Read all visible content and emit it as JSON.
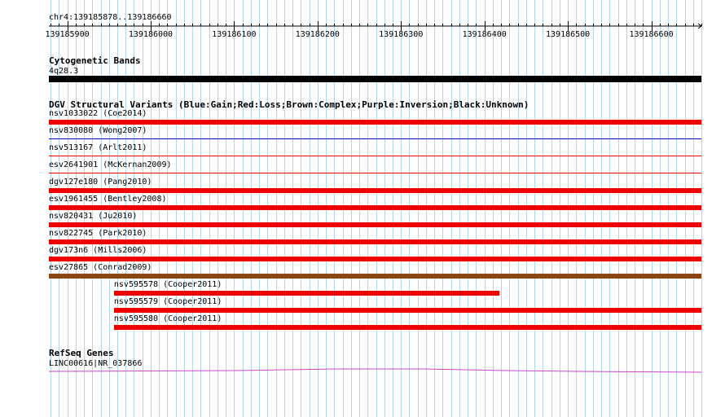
{
  "region": {
    "label": "chr4:139185878..139186660",
    "start": 139185878,
    "end": 139186660
  },
  "ruler": {
    "ticks": [
      {
        "pos": 139185900,
        "label": "139185900"
      },
      {
        "pos": 139186000,
        "label": "139186000"
      },
      {
        "pos": 139186100,
        "label": "139186100"
      },
      {
        "pos": 139186200,
        "label": "139186200"
      },
      {
        "pos": 139186300,
        "label": "139186300"
      },
      {
        "pos": 139186400,
        "label": "139186400"
      },
      {
        "pos": 139186500,
        "label": "139186500"
      },
      {
        "pos": 139186600,
        "label": "139186600"
      }
    ]
  },
  "colors": {
    "grid": "#b0d8e8",
    "ruler": "#000000",
    "band": "#000000",
    "gain": "#0000cc",
    "loss": "#ee0000",
    "complex": "#8b4513",
    "gene": "#cc44cc"
  },
  "tracks": {
    "cytoband": {
      "title": "Cytogenetic Bands",
      "feature": {
        "label": "4q28.3",
        "start": 139185878,
        "end": 139186660
      }
    },
    "dgv": {
      "title": "DGV Structural Variants (Blue:Gain;Red:Loss;Brown:Complex;Purple:Inversion;Black:Unknown)",
      "features": [
        {
          "label": "nsv1033022 (Coe2014)",
          "type": "loss",
          "style": "thick",
          "start": 139185878,
          "end": 139186660
        },
        {
          "label": "nsv830080 (Wong2007)",
          "type": "gain",
          "style": "thin",
          "start": 139185878,
          "end": 139186660
        },
        {
          "label": "nsv513167 (Arlt2011)",
          "type": "loss",
          "style": "thin",
          "start": 139185878,
          "end": 139186660
        },
        {
          "label": "esv2641901 (McKernan2009)",
          "type": "loss",
          "style": "thin",
          "start": 139185878,
          "end": 139186660
        },
        {
          "label": "dgv127e180 (Pang2010)",
          "type": "loss",
          "style": "thick",
          "start": 139185878,
          "end": 139186660
        },
        {
          "label": "esv1961455 (Bentley2008)",
          "type": "loss",
          "style": "thick",
          "start": 139185878,
          "end": 139186660
        },
        {
          "label": "nsv820431 (Ju2010)",
          "type": "loss",
          "style": "thick",
          "start": 139185878,
          "end": 139186660
        },
        {
          "label": "nsv822745 (Park2010)",
          "type": "loss",
          "style": "thick",
          "start": 139185878,
          "end": 139186660
        },
        {
          "label": "dgv173n6 (Mills2006)",
          "type": "loss",
          "style": "thick",
          "start": 139185878,
          "end": 139186660
        },
        {
          "label": "esv27865 (Conrad2009)",
          "type": "complex",
          "style": "thick",
          "start": 139185878,
          "end": 139186660
        },
        {
          "label": "nsv595578 (Cooper2011)",
          "type": "loss",
          "style": "thick",
          "start": 139185956,
          "end": 139186418
        },
        {
          "label": "nsv595579 (Cooper2011)",
          "type": "loss",
          "style": "thick",
          "start": 139185956,
          "end": 139186660
        },
        {
          "label": "nsv595580 (Cooper2011)",
          "type": "loss",
          "style": "thick",
          "start": 139185956,
          "end": 139186660
        }
      ]
    },
    "refseq": {
      "title": "RefSeq Genes",
      "feature": {
        "label": "LINC00616|NR_037866",
        "start": 139185878,
        "end": 139186660
      }
    }
  }
}
